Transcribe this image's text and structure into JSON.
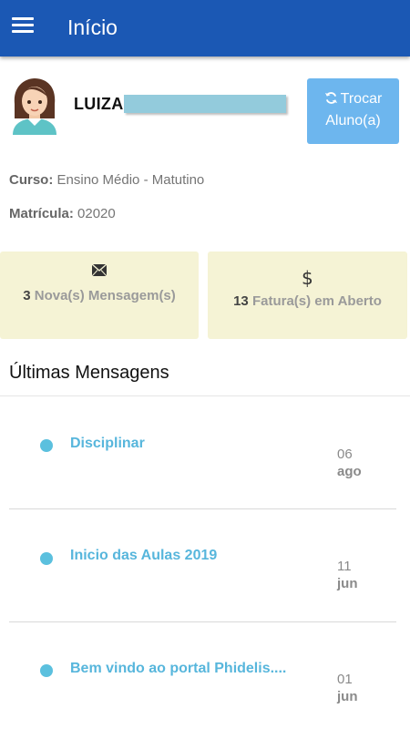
{
  "appbar": {
    "title": "Início",
    "menu_icon": "hamburger-menu-icon"
  },
  "student": {
    "name": "LUIZA",
    "avatar": "student-avatar"
  },
  "switch_button": {
    "icon": "refresh-icon",
    "line1": "Trocar",
    "line2": "Aluno(a)"
  },
  "course": {
    "label": "Curso:",
    "value": "Ensino Médio - Matutino"
  },
  "registration": {
    "label": "Matrícula:",
    "value": "02020"
  },
  "cards": {
    "messages": {
      "icon": "envelope-icon",
      "count": "3",
      "label": "Nova(s) Mensagem(s)"
    },
    "invoices": {
      "icon": "dollar-icon",
      "symbol": "$",
      "count": "13",
      "label": "Fatura(s) em Aberto"
    }
  },
  "recent": {
    "title": "Últimas Mensagens",
    "items": [
      {
        "subject": "Disciplinar",
        "day": "06",
        "month": "ago"
      },
      {
        "subject": "Inicio das Aulas 2019",
        "day": "11",
        "month": "jun"
      },
      {
        "subject": "Bem vindo ao portal Phidelis....",
        "day": "01",
        "month": "jun"
      }
    ]
  },
  "colors": {
    "appbar": "#1b58b4",
    "button": "#6db6ee",
    "card": "#f5f3d5",
    "link": "#57b6dc",
    "dot": "#5bc0de"
  }
}
